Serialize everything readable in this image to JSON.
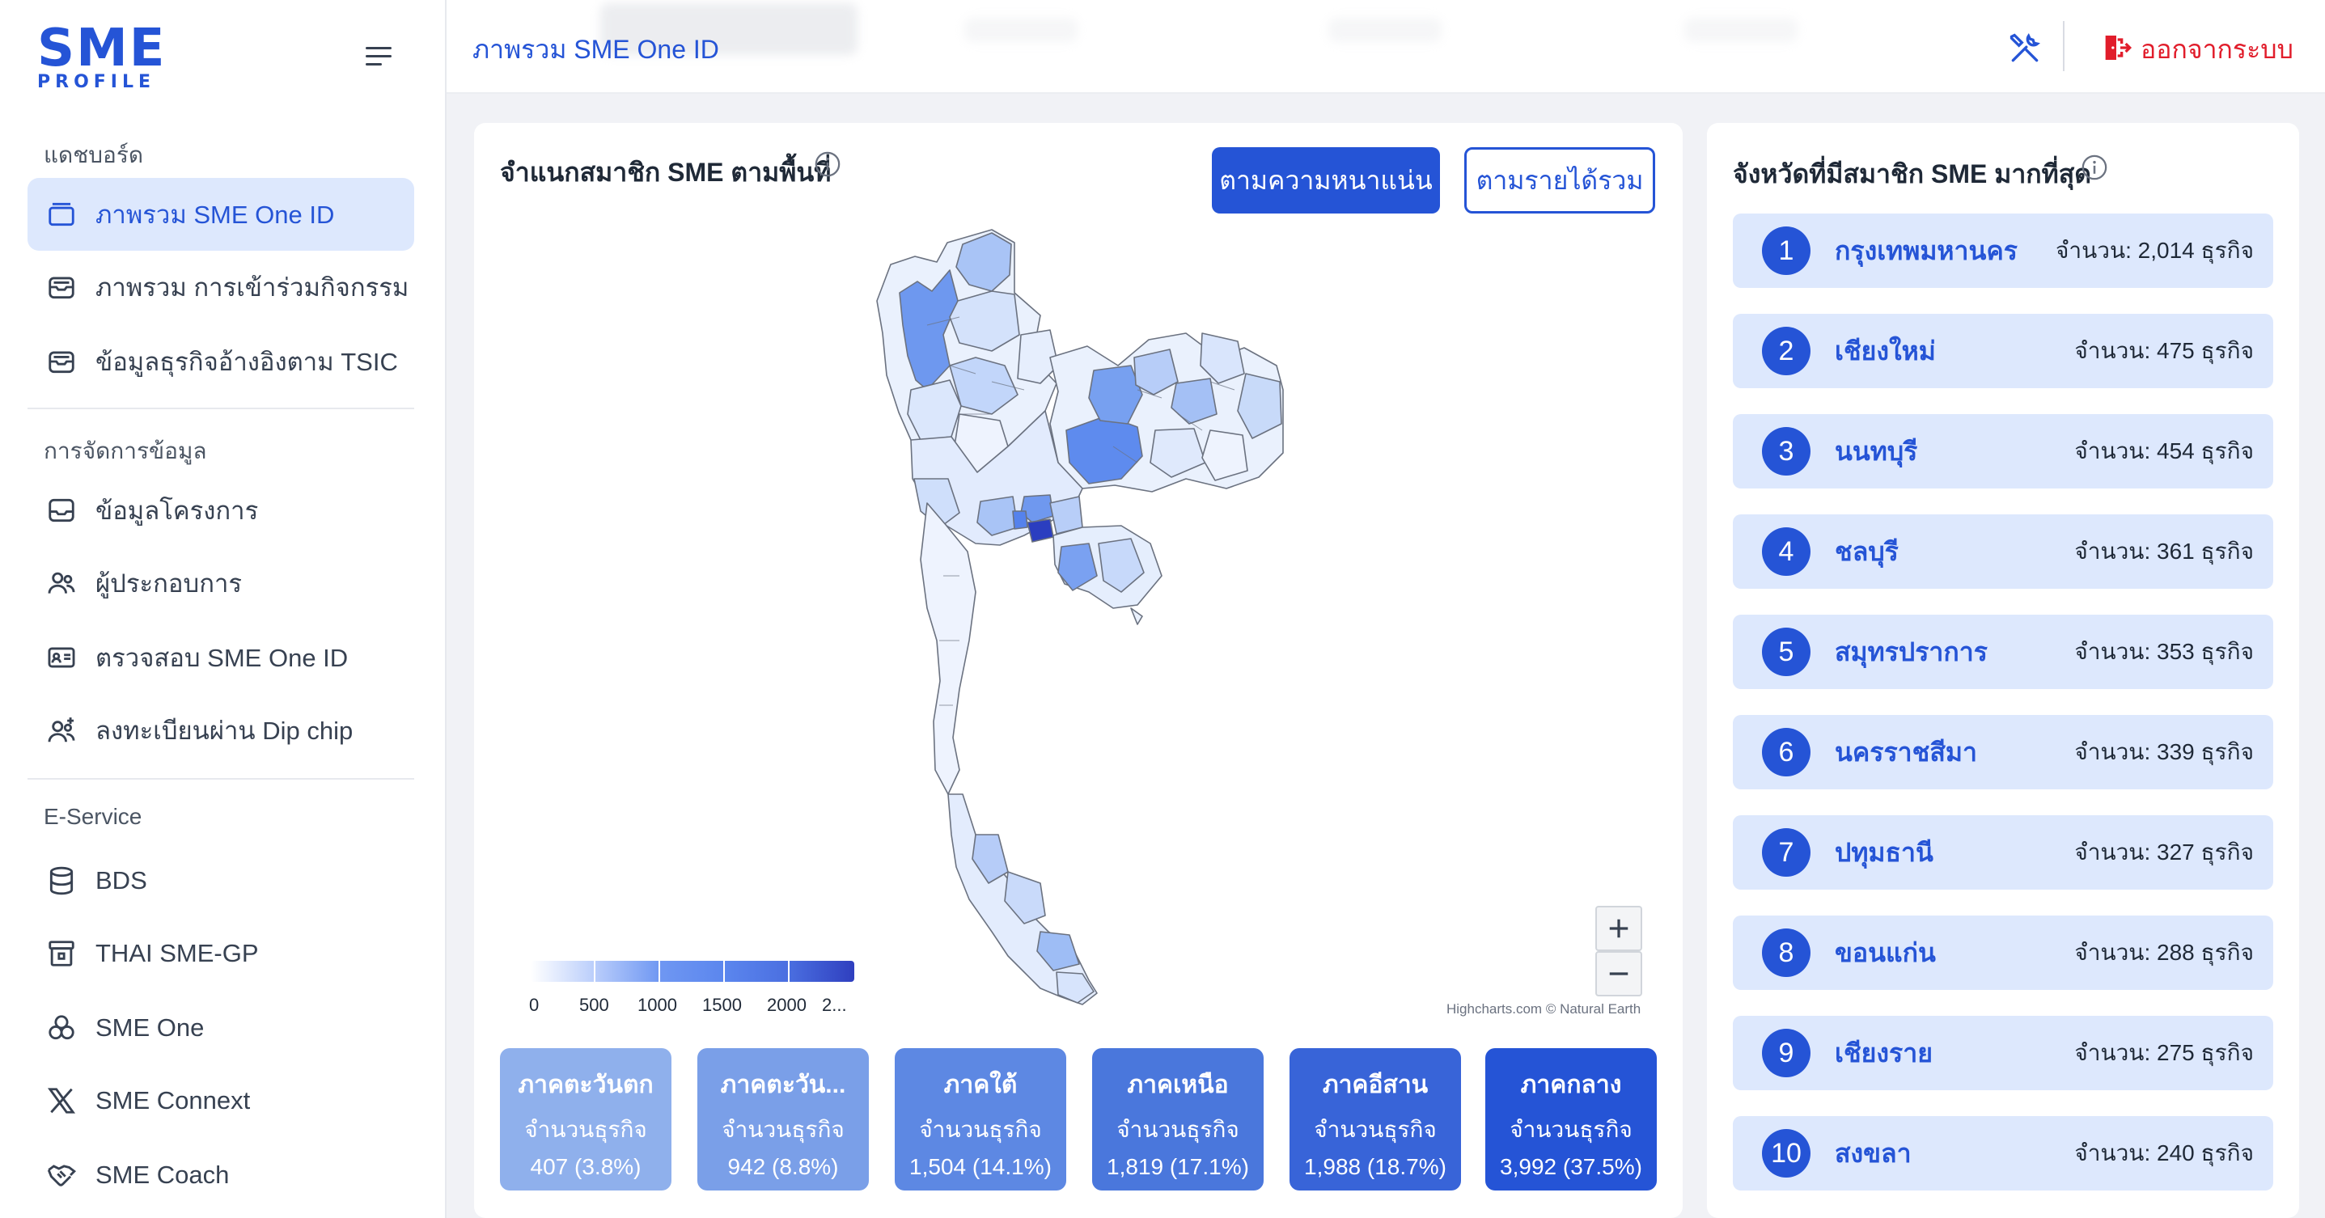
{
  "logo": {
    "main": "SME",
    "sub": "PROFILE"
  },
  "sidebar": {
    "sections": [
      {
        "title": "แดชบอร์ด"
      },
      {
        "title": "การจัดการข้อมูล"
      },
      {
        "title": "E-Service"
      }
    ],
    "items": [
      {
        "label": "ภาพรวม SME One ID",
        "icon": "layers-icon",
        "active": true
      },
      {
        "label": "ภาพรวม การเข้าร่วมกิจกรรม",
        "icon": "inbox-stack-icon"
      },
      {
        "label": "ข้อมูลธุรกิจอ้างอิงตาม TSIC",
        "icon": "inbox-stack-icon"
      },
      {
        "label": "ข้อมูลโครงการ",
        "icon": "inbox-icon"
      },
      {
        "label": "ผู้ประกอบการ",
        "icon": "users-icon"
      },
      {
        "label": "ตรวจสอบ SME One ID",
        "icon": "id-card-icon"
      },
      {
        "label": "ลงทะเบียนผ่าน Dip chip",
        "icon": "user-plus-icon"
      },
      {
        "label": "BDS",
        "icon": "database-icon"
      },
      {
        "label": "THAI SME-GP",
        "icon": "archive-icon"
      },
      {
        "label": "SME One",
        "icon": "circles-icon"
      },
      {
        "label": "SME Connext",
        "icon": "x-logo-icon"
      },
      {
        "label": "SME Coach",
        "icon": "handshake-icon"
      }
    ]
  },
  "header": {
    "title": "ภาพรวม SME One ID",
    "logout_label": "ออกจากระบบ"
  },
  "map_card": {
    "title": "จำแนกสมาชิก SME ตามพื้นที่",
    "btn_density": "ตามความหนาแน่น",
    "btn_revenue": "ตามรายได้รวม",
    "credit": "Highcharts.com © Natural Earth",
    "legend_labels": [
      "0",
      "500",
      "1000",
      "1500",
      "2000",
      "2..."
    ],
    "regions": [
      {
        "name": "ภาคตะวันตก",
        "sub": "จำนวนธุรกิจ",
        "value": "407 (3.8%)",
        "color": "#8fb0ec"
      },
      {
        "name": "ภาคตะวัน...",
        "sub": "จำนวนธุรกิจ",
        "value": "942 (8.8%)",
        "color": "#7a9fe8"
      },
      {
        "name": "ภาคใต้",
        "sub": "จำนวนธุรกิจ",
        "value": "1,504 (14.1%)",
        "color": "#5d88e3"
      },
      {
        "name": "ภาคเหนือ",
        "sub": "จำนวนธุรกิจ",
        "value": "1,819 (17.1%)",
        "color": "#4a77dc"
      },
      {
        "name": "ภาคอีสาน",
        "sub": "จำนวนธุรกิจ",
        "value": "1,988 (18.7%)",
        "color": "#3864d8"
      },
      {
        "name": "ภาคกลาง",
        "sub": "จำนวนธุรกิจ",
        "value": "3,992 (37.5%)",
        "color": "#2554d6"
      }
    ]
  },
  "rank_card": {
    "title": "จังหวัดที่มีสมาชิก SME มากที่สุด",
    "items": [
      {
        "rank": "1",
        "name": "กรุงเทพมหานคร",
        "count": "จำนวน: 2,014 ธุรกิจ"
      },
      {
        "rank": "2",
        "name": "เชียงใหม่",
        "count": "จำนวน: 475 ธุรกิจ"
      },
      {
        "rank": "3",
        "name": "นนทบุรี",
        "count": "จำนวน: 454 ธุรกิจ"
      },
      {
        "rank": "4",
        "name": "ชลบุรี",
        "count": "จำนวน: 361 ธุรกิจ"
      },
      {
        "rank": "5",
        "name": "สมุทรปราการ",
        "count": "จำนวน: 353 ธุรกิจ"
      },
      {
        "rank": "6",
        "name": "นครราชสีมา",
        "count": "จำนวน: 339 ธุรกิจ"
      },
      {
        "rank": "7",
        "name": "ปทุมธานี",
        "count": "จำนวน: 327 ธุรกิจ"
      },
      {
        "rank": "8",
        "name": "ขอนแก่น",
        "count": "จำนวน: 288 ธุรกิจ"
      },
      {
        "rank": "9",
        "name": "เชียงราย",
        "count": "จำนวน: 275 ธุรกิจ"
      },
      {
        "rank": "10",
        "name": "สงขลา",
        "count": "จำนวน: 240 ธุรกิจ"
      }
    ]
  },
  "colors": {
    "brand": "#2554d6",
    "active_bg": "#dde8fd",
    "logout": "#e11d2b"
  }
}
